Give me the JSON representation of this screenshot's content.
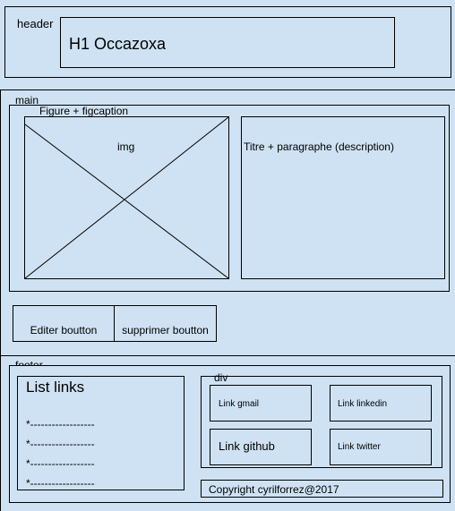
{
  "header": {
    "label": "header",
    "title": "H1 Occazoxa"
  },
  "main": {
    "label": "main",
    "figure_label": "Figure + figcaption",
    "img_label": "img",
    "description_label": "Titre + paragraphe (description)",
    "edit_button": "Editer boutton",
    "delete_button": "supprimer boutton"
  },
  "footer": {
    "label": "footer",
    "list_title": "List links",
    "list_items": [
      "*------------------",
      "*------------------",
      "*------------------",
      "*------------------"
    ],
    "div_label": "div",
    "links": {
      "gmail": "Link gmail",
      "linkedin": "Link linkedin",
      "github": "Link github",
      "twitter": "Link twitter"
    },
    "copyright": "Copyright cyrilforrez@2017"
  }
}
